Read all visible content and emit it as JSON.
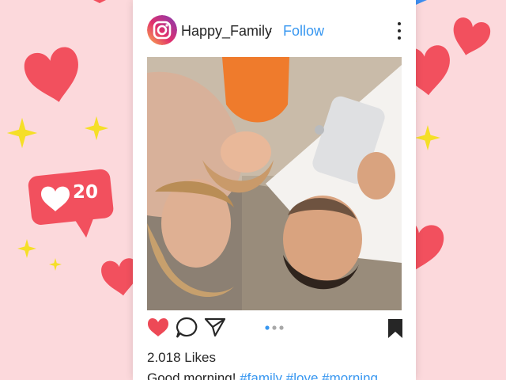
{
  "post": {
    "username": "Happy_Family",
    "separator": "·",
    "follow_label": "Follow",
    "likes_text": "2.018 Likes",
    "caption_text": "Good morning!",
    "caption_tags": "#family #love #morning"
  },
  "notification": {
    "like_count": "20"
  },
  "colors": {
    "background": "#fcd9dc",
    "heart": "#f2505e",
    "accent_blue": "#3897f0",
    "sparkle": "#f5df27"
  },
  "icons": {
    "avatar": "instagram-logo-icon",
    "more": "more-vertical-icon",
    "like": "heart-filled-icon",
    "comment": "comment-icon",
    "share": "send-icon",
    "save": "bookmark-icon"
  },
  "carousel": {
    "total": 3,
    "active": 0
  }
}
